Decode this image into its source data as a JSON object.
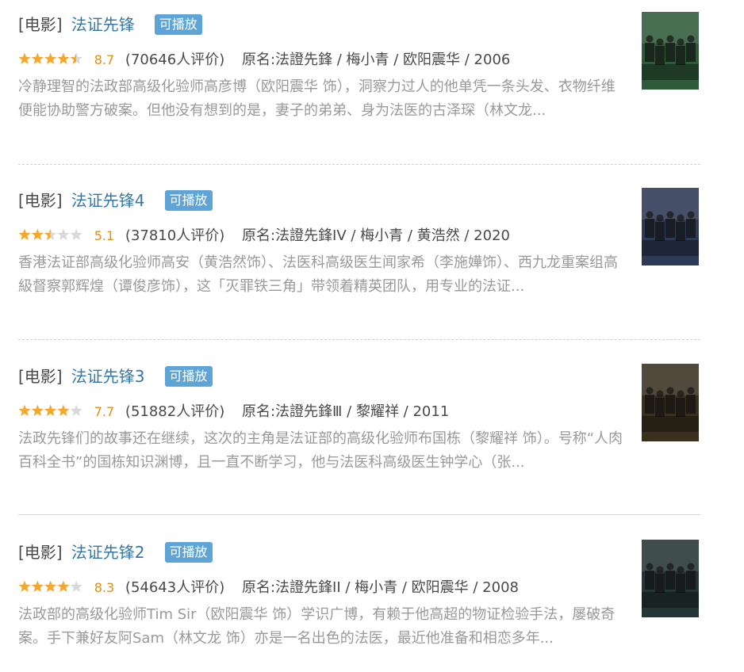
{
  "items": [
    {
      "type": "[电影]",
      "title": "法证先锋",
      "badge": "可播放",
      "rating": 4.5,
      "score": "8.7",
      "votes": "(70646人评价)",
      "meta": "原名:法證先鋒 / 梅小青 / 欧阳震华 / 2006",
      "desc": "冷静理智的法政部高级化验师高彦博（欧阳震华 饰），洞察力过人的他单凭一条头发、衣物纤维便能协助警方破案。但他没有想到的是，妻子的弟弟、身为法医的古泽琛（林文龙...",
      "poster_color": "#2f5a3a",
      "poster_alt": "法證先鋒"
    },
    {
      "type": "[电影]",
      "title": "法证先锋4",
      "badge": "可播放",
      "rating": 2.5,
      "score": "5.1",
      "votes": "(37810人评价)",
      "meta": "原名:法證先鋒IV / 梅小青 / 黄浩然 / 2020",
      "desc": "香港法证部高级化验师高安（黄浩然饰）、法医科高级医生闻家希（李施嬅饰）、西九龙重案组高級督察郭辉煌（谭俊彦饰），这「灭罪铁三角」带领着精英团队，用专业的法证...",
      "poster_color": "#2d3a55",
      "poster_alt": "法證先鋒IV"
    },
    {
      "type": "[电影]",
      "title": "法证先锋3",
      "badge": "可播放",
      "rating": 4,
      "score": "7.7",
      "votes": "(51882人评价)",
      "meta": "原名:法證先鋒Ⅲ / 黎耀祥 / 2011",
      "desc": "法政先锋们的故事还在继续，这次的主角是法证部的高级化验师布国栋（黎耀祥 饰）。号称“人肉百科全书”的国栋知识渊博，且一直不断学习，他与法医科高级医生钟学心（张...",
      "poster_color": "#3a3020",
      "poster_alt": "法證先鋒III"
    },
    {
      "type": "[电影]",
      "title": "法证先锋2",
      "badge": "可播放",
      "rating": 4,
      "score": "8.3",
      "votes": "(54643人评价)",
      "meta": "原名:法證先鋒II / 梅小青 / 欧阳震华 / 2008",
      "desc": "法政部的高级化验师Tim Sir（欧阳震华 饰）学识广博，有赖于他高超的物证检验手法，屡破奇案。手下兼好友阿Sam（林文龙 饰）亦是一名出色的法医，最近他准备和相恋多年...",
      "poster_color": "#253535",
      "poster_alt": "法證先鋒II"
    }
  ],
  "star_colors": {
    "on": "#f3a82d",
    "off": "#d9d9d9"
  }
}
